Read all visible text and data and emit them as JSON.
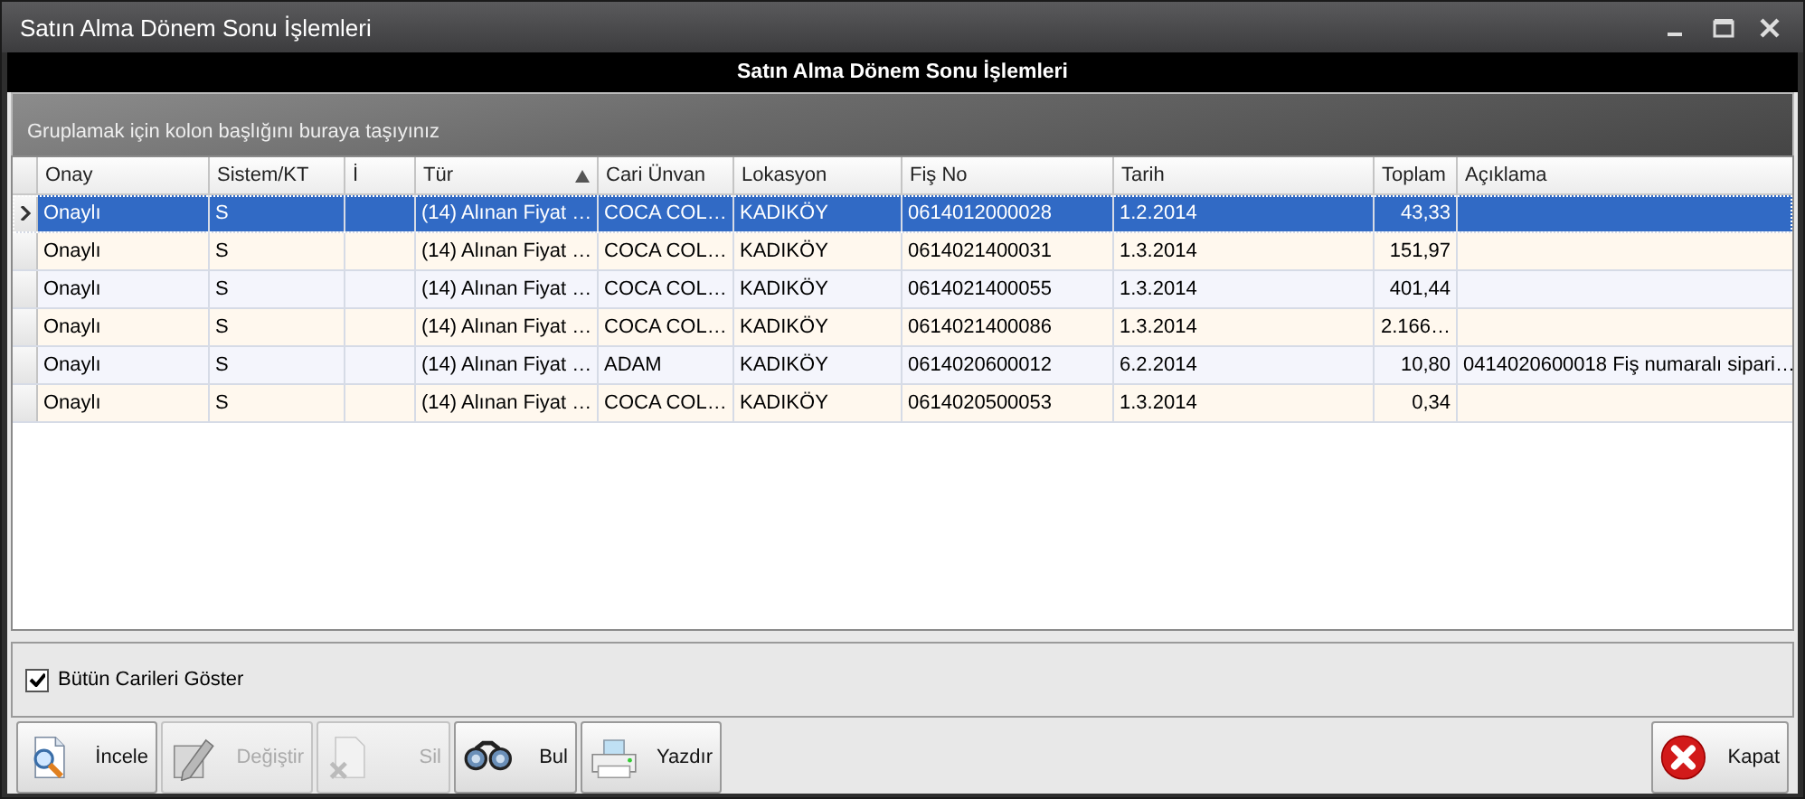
{
  "window": {
    "title": "Satın Alma Dönem Sonu İşlemleri"
  },
  "header": {
    "title": "Satın Alma Dönem Sonu İşlemleri"
  },
  "group_panel": {
    "hint": "Gruplamak için kolon başlığını buraya taşıyınız"
  },
  "table": {
    "columns": [
      {
        "label": "Onay",
        "sorted": false
      },
      {
        "label": "Sistem/KT",
        "sorted": false
      },
      {
        "label": "İ",
        "sorted": false
      },
      {
        "label": "Tür",
        "sorted": true
      },
      {
        "label": "Cari Ünvan",
        "sorted": false
      },
      {
        "label": "Lokasyon",
        "sorted": false
      },
      {
        "label": "Fiş No",
        "sorted": false
      },
      {
        "label": "Tarih",
        "sorted": false
      },
      {
        "label": "Toplam",
        "sorted": false
      },
      {
        "label": "Açıklama",
        "sorted": false
      }
    ],
    "rows": [
      {
        "selected": true,
        "cells": [
          "Onaylı",
          "S",
          "",
          "(14) Alınan Fiyat …",
          "COCA COL…",
          "KADIKÖY",
          "0614012000028",
          "1.2.2014",
          "43,33",
          ""
        ]
      },
      {
        "selected": false,
        "cells": [
          "Onaylı",
          "S",
          "",
          "(14) Alınan Fiyat …",
          "COCA COL…",
          "KADIKÖY",
          "0614021400031",
          "1.3.2014",
          "151,97",
          ""
        ]
      },
      {
        "selected": false,
        "cells": [
          "Onaylı",
          "S",
          "",
          "(14) Alınan Fiyat …",
          "COCA COL…",
          "KADIKÖY",
          "0614021400055",
          "1.3.2014",
          "401,44",
          ""
        ]
      },
      {
        "selected": false,
        "cells": [
          "Onaylı",
          "S",
          "",
          "(14) Alınan Fiyat …",
          "COCA COL…",
          "KADIKÖY",
          "0614021400086",
          "1.3.2014",
          "2.166…",
          ""
        ]
      },
      {
        "selected": false,
        "cells": [
          "Onaylı",
          "S",
          "",
          "(14) Alınan Fiyat …",
          "ADAM",
          "KADIKÖY",
          "0614020600012",
          "6.2.2014",
          "10,80",
          "0414020600018 Fiş numaralı sipari…"
        ]
      },
      {
        "selected": false,
        "cells": [
          "Onaylı",
          "S",
          "",
          "(14) Alınan Fiyat …",
          "COCA COL…",
          "KADIKÖY",
          "0614020500053",
          "1.3.2014",
          "0,34",
          ""
        ]
      }
    ]
  },
  "options": {
    "label": "Bütün Carileri Göster",
    "checked": true
  },
  "buttons": [
    {
      "kind": "inspect",
      "label": "İncele",
      "disabled": false
    },
    {
      "kind": "edit",
      "label": "Değiştir",
      "disabled": true
    },
    {
      "kind": "delete",
      "label": "Sil",
      "disabled": true
    },
    {
      "kind": "find",
      "label": "Bul",
      "disabled": false
    },
    {
      "kind": "print",
      "label": "Yazdır",
      "disabled": false
    }
  ],
  "close_button": {
    "kind": "close",
    "label": "Kapat",
    "disabled": false
  }
}
